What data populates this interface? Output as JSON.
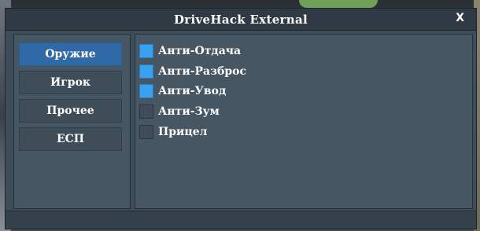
{
  "window": {
    "title": "DriveHack External",
    "close_label": "X"
  },
  "sidebar": {
    "items": [
      {
        "label": "Оружие",
        "active": true
      },
      {
        "label": "Игрок",
        "active": false
      },
      {
        "label": "Прочее",
        "active": false
      },
      {
        "label": "ЕСП",
        "active": false
      }
    ]
  },
  "options": [
    {
      "label": "Анти-Отдача",
      "checked": true
    },
    {
      "label": "Анти-Разброс",
      "checked": true
    },
    {
      "label": "Анти-Увод",
      "checked": true
    },
    {
      "label": "Анти-Зум",
      "checked": false
    },
    {
      "label": "Прицел",
      "checked": false
    }
  ],
  "colors": {
    "accent": "#2f6aa7",
    "checkbox_checked": "#3aa0f0",
    "panel": "#465662",
    "window": "#3e4d59"
  }
}
